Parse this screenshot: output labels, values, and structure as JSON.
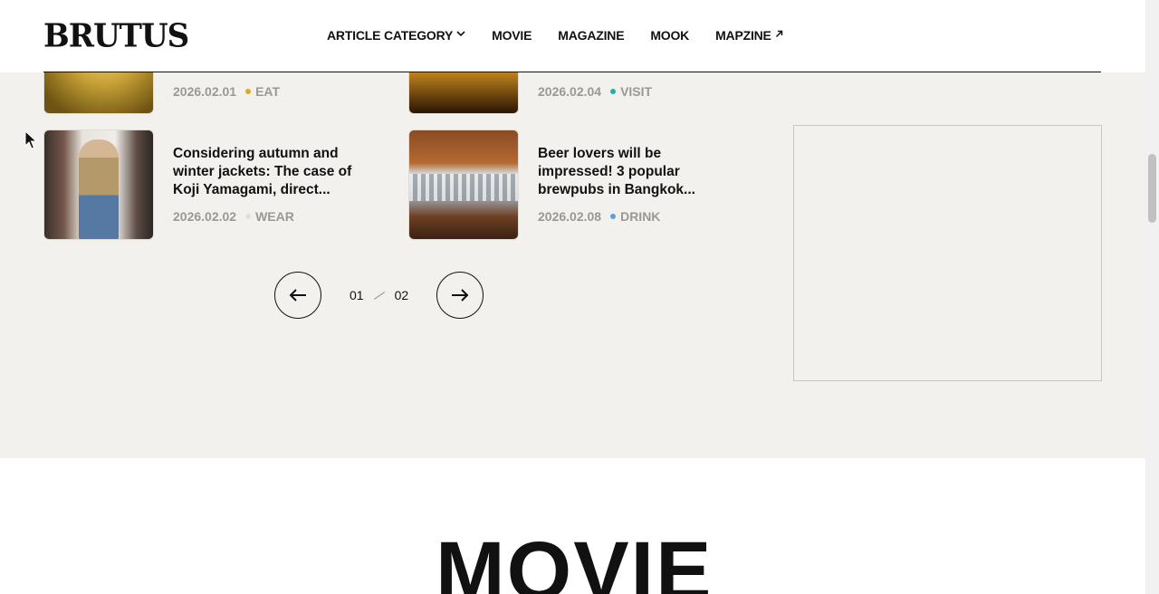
{
  "header": {
    "logo": "BRUTUS",
    "nav": [
      {
        "label": "ARTICLE CATEGORY",
        "icon": "chevron-down-icon"
      },
      {
        "label": "MOVIE"
      },
      {
        "label": "MAGAZINE"
      },
      {
        "label": "MOOK"
      },
      {
        "label": "MAPZINE",
        "icon": "external-link-icon"
      }
    ]
  },
  "articles": [
    {
      "date": "2026.02.01",
      "category": "EAT",
      "dot_color": "#e0a91f"
    },
    {
      "date": "2026.02.04",
      "category": "VISIT",
      "dot_color": "#1fb3a3"
    },
    {
      "title": "Considering autumn and winter jackets: The case of Koji Yamagami, direct...",
      "date": "2026.02.02",
      "category": "WEAR",
      "dot_color": "#e2e0dc"
    },
    {
      "title": "Beer lovers will be impressed! 3 popular brewpubs in Bangkok...",
      "date": "2026.02.08",
      "category": "DRINK",
      "dot_color": "#5b9ee0"
    }
  ],
  "pager": {
    "current": "01",
    "total": "02",
    "prev_icon": "arrow-left-icon",
    "next_icon": "arrow-right-icon"
  },
  "section": {
    "heading": "MOVIE"
  }
}
